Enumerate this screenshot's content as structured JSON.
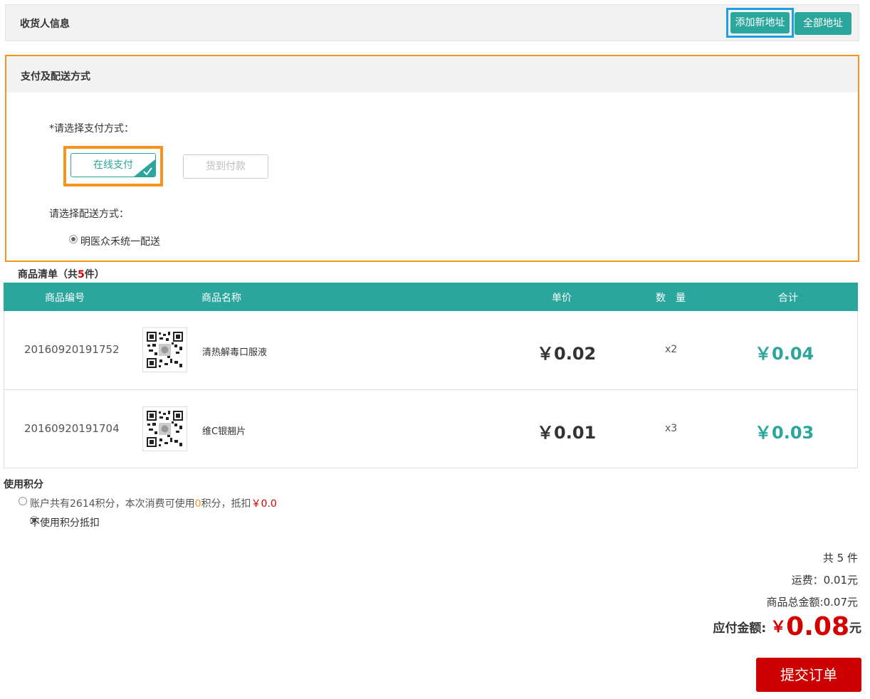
{
  "receiver": {
    "title": "收货人信息",
    "add_address": "添加新地址",
    "all_addresses": "全部地址"
  },
  "payment": {
    "title": "支付及配送方式",
    "select_label": "*请选择支付方式：",
    "options": [
      "在线支付",
      "货到付款"
    ],
    "selected": "在线支付",
    "delivery_label": "请选择配送方式：",
    "delivery_option": "明医众禾统一配送"
  },
  "products": {
    "title_prefix": "商品清单（共",
    "count": "5",
    "title_suffix": "件）",
    "headers": [
      "商品编号",
      "商品名称",
      "单价",
      "数　量",
      "合计"
    ],
    "rows": [
      {
        "code": "20160920191752",
        "name": "清热解毒口服液",
        "unit_price": "￥0.02",
        "qty": "x2",
        "total": "￥0.04"
      },
      {
        "code": "20160920191704",
        "name": "维C银翘片",
        "unit_price": "￥0.01",
        "qty": "x3",
        "total": "￥0.03"
      }
    ]
  },
  "points": {
    "title": "使用积分",
    "option1_a": "账户共有2614积分，本次消费可使用",
    "option1_usable": "0",
    "option1_b": "积分，抵扣",
    "option1_amount": "￥0.0",
    "option2": "不使用积分抵扣"
  },
  "summary": {
    "count": "共 5 件",
    "shipping": "运费：0.01元",
    "goods_total": "商品总金额:0.07元",
    "payable_label": "应付金额:",
    "payable_currency": "￥",
    "payable_amount": "0.08",
    "payable_unit": "元",
    "submit": "提交订单"
  },
  "colors": {
    "teal": "#2aa69c",
    "orange_highlight": "#f7941d",
    "blue_highlight": "#1ea0e0",
    "red": "#cc0000"
  }
}
